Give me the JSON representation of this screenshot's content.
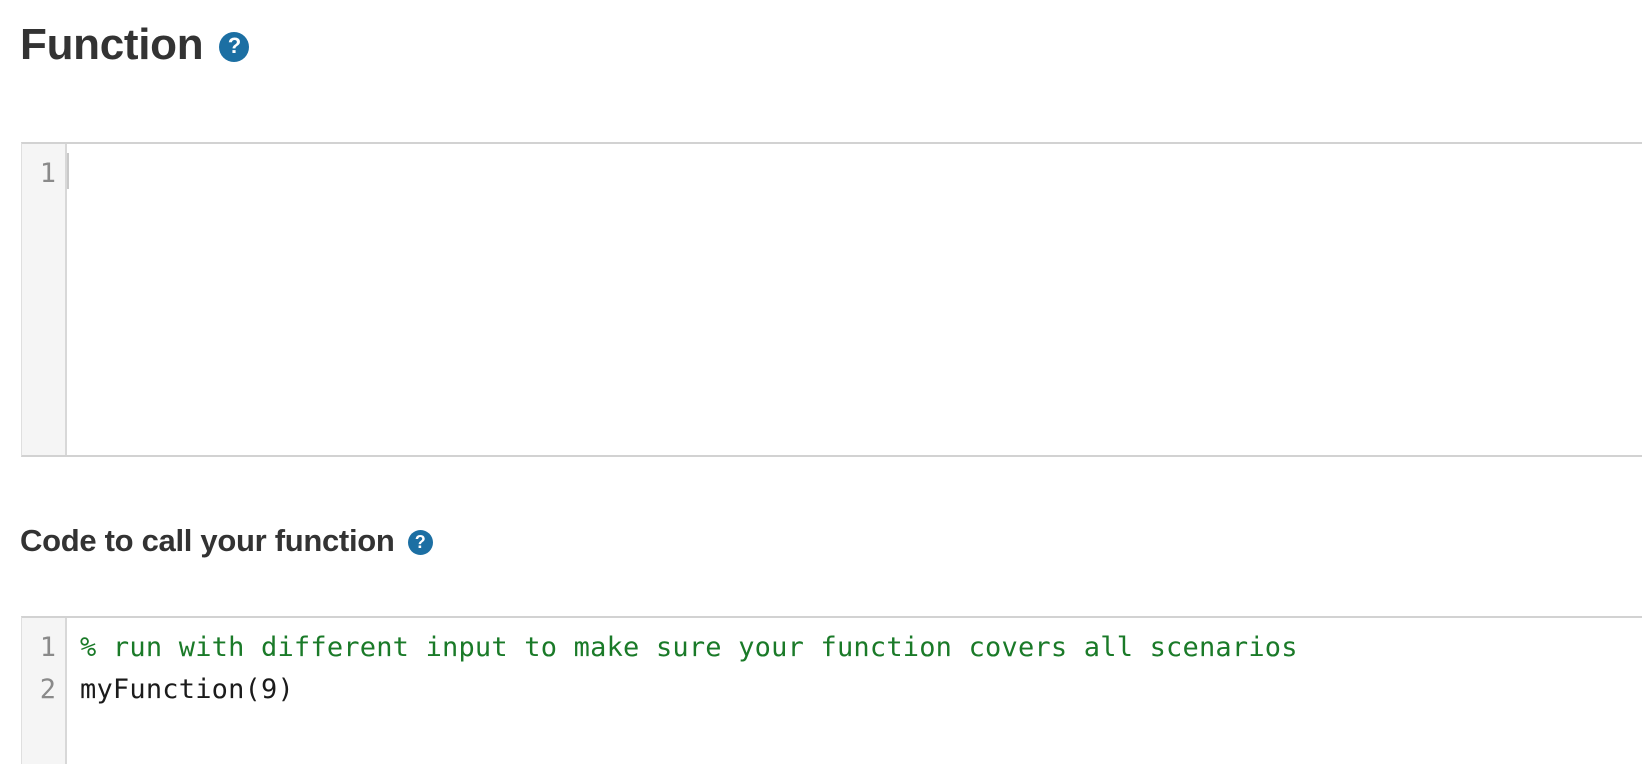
{
  "sections": [
    {
      "heading": "Function",
      "help_icon": "help-circle-icon",
      "help_glyph": "?"
    },
    {
      "heading": "Code to call your function",
      "help_icon": "help-circle-icon",
      "help_glyph": "?"
    }
  ],
  "editors": {
    "function_editor": {
      "line_numbers": [
        "1"
      ],
      "lines": [
        ""
      ],
      "placeholder": ""
    },
    "call_editor": {
      "line_numbers": [
        "1",
        "2"
      ],
      "lines": [
        "% run with different input to make sure your function covers all scenarios",
        "myFunction(9)"
      ]
    }
  },
  "colors": {
    "help_icon_blue": "#1c6fa3",
    "comment_green": "#1a7a28",
    "code_black": "#1b1b1b",
    "gutter_bg": "#f5f5f5",
    "gutter_text": "#8a8a8a",
    "border": "#d2d2d2",
    "heading_text": "#333333"
  }
}
